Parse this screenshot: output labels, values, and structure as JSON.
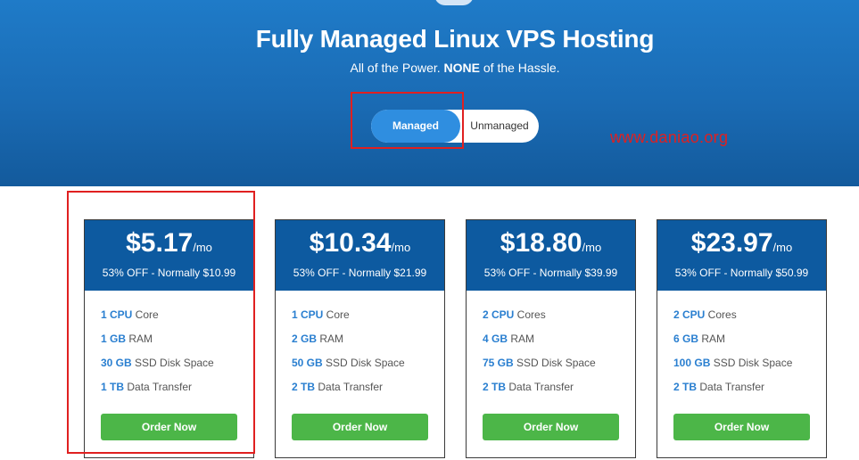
{
  "hero": {
    "title": "Fully Managed Linux VPS Hosting",
    "subtitle_before": "All of the Power. ",
    "subtitle_bold": "NONE",
    "subtitle_after": " of the Hassle."
  },
  "toggle": {
    "options": [
      {
        "label": "Managed",
        "selected": true
      },
      {
        "label": "Unmanaged",
        "selected": false
      }
    ]
  },
  "watermark": "www.daniao.org",
  "plans": [
    {
      "price": "$5.17",
      "per": "/mo",
      "discount": "53% OFF - Normally $10.99",
      "features": [
        {
          "qty": "1 CPU",
          "label": " Core"
        },
        {
          "qty": "1 GB",
          "label": " RAM"
        },
        {
          "qty": "30 GB",
          "label": " SSD Disk Space"
        },
        {
          "qty": "1 TB",
          "label": " Data Transfer"
        }
      ],
      "cta": "Order Now"
    },
    {
      "price": "$10.34",
      "per": "/mo",
      "discount": "53% OFF - Normally $21.99",
      "features": [
        {
          "qty": "1 CPU",
          "label": " Core"
        },
        {
          "qty": "2 GB",
          "label": " RAM"
        },
        {
          "qty": "50 GB",
          "label": " SSD Disk Space"
        },
        {
          "qty": "2 TB",
          "label": " Data Transfer"
        }
      ],
      "cta": "Order Now"
    },
    {
      "price": "$18.80",
      "per": "/mo",
      "discount": "53% OFF - Normally $39.99",
      "features": [
        {
          "qty": "2 CPU",
          "label": " Cores"
        },
        {
          "qty": "4 GB",
          "label": " RAM"
        },
        {
          "qty": "75 GB",
          "label": " SSD Disk Space"
        },
        {
          "qty": "2 TB",
          "label": " Data Transfer"
        }
      ],
      "cta": "Order Now"
    },
    {
      "price": "$23.97",
      "per": "/mo",
      "discount": "53% OFF - Normally $50.99",
      "features": [
        {
          "qty": "2 CPU",
          "label": " Cores"
        },
        {
          "qty": "6 GB",
          "label": " RAM"
        },
        {
          "qty": "100 GB",
          "label": " SSD Disk Space"
        },
        {
          "qty": "2 TB",
          "label": " Data Transfer"
        }
      ],
      "cta": "Order Now"
    }
  ]
}
